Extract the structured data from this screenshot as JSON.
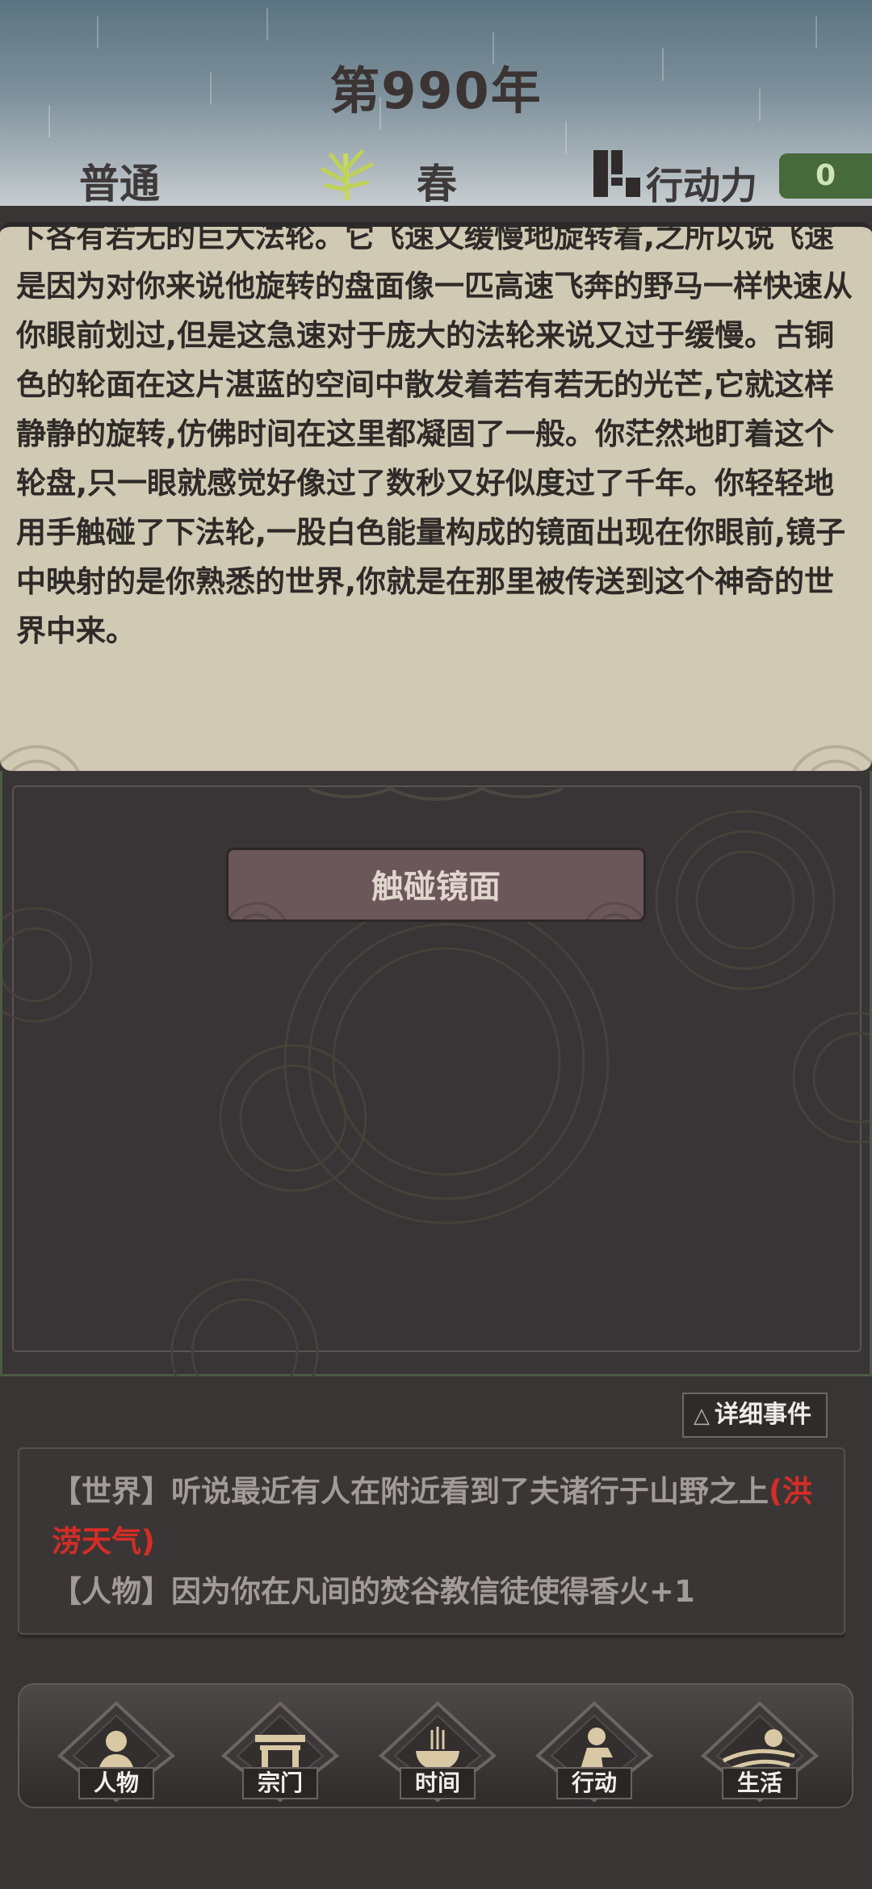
{
  "header": {
    "year": "第990年",
    "difficulty": "普通",
    "season": "春",
    "action_points_label": "行动力",
    "action_points_value": "0",
    "colors": {
      "ap_badge": "#466a3c",
      "season_icon": "#c9d860"
    }
  },
  "story": {
    "text": "下各有若无的巨大法轮。它飞速又缓慢地旋转着,之所以说飞速是因为对你来说他旋转的盘面像一匹高速飞奔的野马一样快速从你眼前划过,但是这急速对于庞大的法轮来说又过于缓慢。古铜色的轮面在这片湛蓝的空间中散发着若有若无的光芒,它就这样静静的旋转,仿佛时间在这里都凝固了一般。你茫然地盯着这个轮盘,只一眼就感觉好像过了数秒又好似度过了千年。你轻轻地用手触碰了下法轮,一股白色能量构成的镜面出现在你眼前,镜子中映射的是你熟悉的世界,你就是在那里被传送到这个神奇的世界中来。"
  },
  "action_button": {
    "label": "触碰镜面"
  },
  "detail_button": {
    "icon": "△",
    "label": "详细事件"
  },
  "log": {
    "world_prefix": "【世界】听说最近有人在附近看到了夫诸行于山野之上",
    "world_highlight": "(洪涝天气)",
    "character_line": "【人物】因为你在凡间的焚谷教信徒使得香火+1",
    "colors": {
      "highlight": "#d52d25"
    }
  },
  "nav": {
    "items": [
      {
        "label": "人物",
        "icon": "person-icon"
      },
      {
        "label": "宗门",
        "icon": "gate-icon"
      },
      {
        "label": "时间",
        "icon": "incense-burner-icon"
      },
      {
        "label": "行动",
        "icon": "action-icon"
      },
      {
        "label": "生活",
        "icon": "landscape-icon"
      }
    ]
  }
}
